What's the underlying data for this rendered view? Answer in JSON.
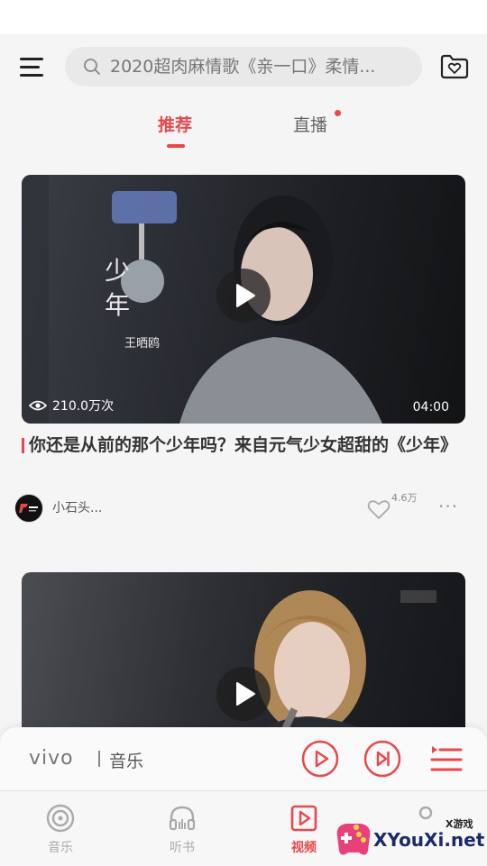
{
  "search": {
    "placeholder": "2020超肉麻情歌《亲一口》柔情..."
  },
  "tabs": [
    {
      "label": "推荐",
      "active": true
    },
    {
      "label": "直播",
      "active": false,
      "has_dot": true
    }
  ],
  "videos": [
    {
      "views": "210.0万次",
      "duration": "04:00",
      "overlay_text": "少年",
      "overlay_sub": "王晒鸥",
      "title": "你还是从前的那个少年吗？来自元气少女超甜的《少年》",
      "author": "小石头...",
      "likes": "4.6万"
    },
    {
      "views": "",
      "duration": "",
      "title": "",
      "author": ""
    }
  ],
  "player": {
    "brand": "vivo",
    "music_label": "音乐"
  },
  "nav": [
    {
      "label": "音乐",
      "icon": "disc-icon",
      "active": false
    },
    {
      "label": "听书",
      "icon": "headphones-icon",
      "active": false
    },
    {
      "label": "视频",
      "icon": "video-play-icon",
      "active": true
    },
    {
      "label": "",
      "icon": "search-icon",
      "active": false
    }
  ],
  "watermark": {
    "text": "XYouXi.net",
    "sub": "X游戏"
  },
  "colors": {
    "accent": "#e8484b",
    "background": "#f5f5f5"
  }
}
